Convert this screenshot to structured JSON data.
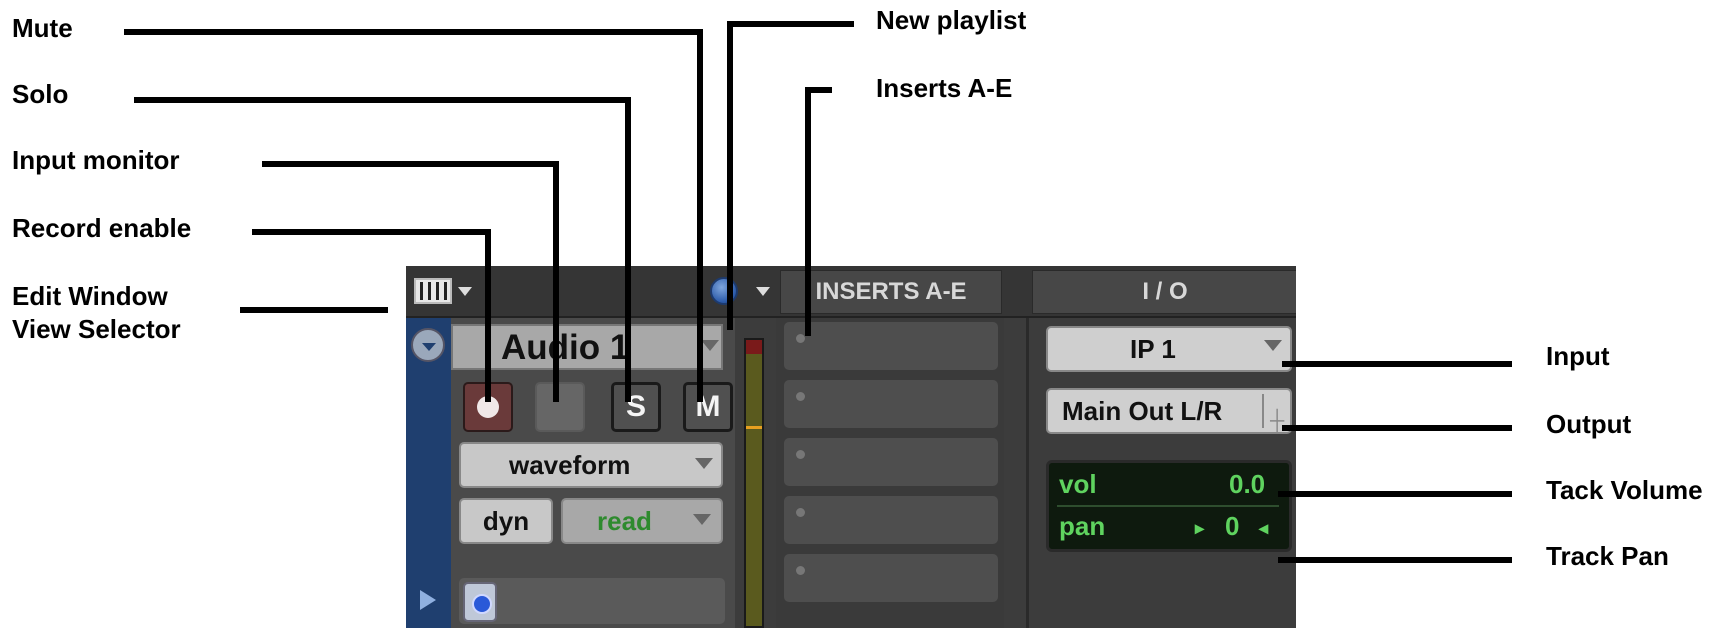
{
  "annotations": {
    "mute": "Mute",
    "solo": "Solo",
    "input_monitor": "Input monitor",
    "record_enable": "Record enable",
    "edit_window_view_selector_line1": "Edit Window",
    "edit_window_view_selector_line2": "View Selector",
    "new_playlist": "New playlist",
    "inserts_a_e": "Inserts A-E",
    "input": "Input",
    "output": "Output",
    "track_volume": "Tack Volume",
    "track_pan": "Track Pan"
  },
  "panel": {
    "header": {
      "inserts": "INSERTS A-E",
      "io": "I / O"
    },
    "track": {
      "name": "Audio 1",
      "solo_label": "S",
      "mute_label": "M",
      "view": "waveform",
      "dyn": "dyn",
      "automation_mode": "read"
    },
    "io": {
      "input": "IP 1",
      "output": "Main Out L/R",
      "vol_label": "vol",
      "vol_value": "0.0",
      "pan_label": "pan",
      "pan_value": "0"
    }
  },
  "colors": {
    "panel_bg": "#3c3c3c",
    "track_strip": "#1f3f6f",
    "display_green": "#5fd35f",
    "meter_level": "#e8a020"
  },
  "icons": [
    "edit-window-view-icon",
    "new-playlist-icon",
    "record-dot-icon",
    "clock-icon",
    "play-triangle-icon",
    "track-menu-icon"
  ]
}
